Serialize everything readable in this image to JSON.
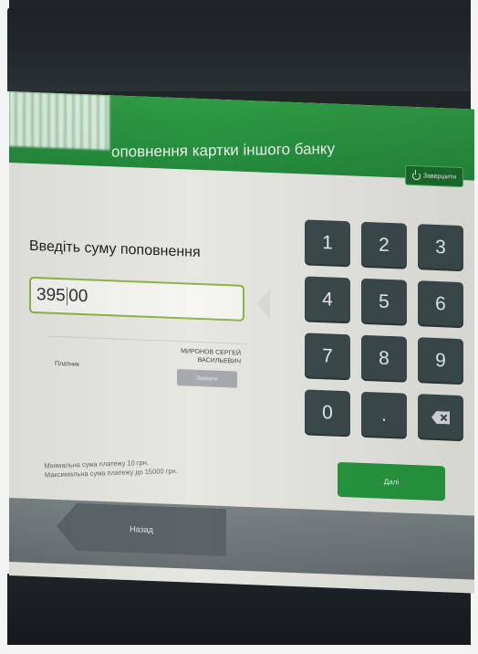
{
  "header": {
    "title": "оповнення картки іншого банку",
    "exit_label": "Завершити"
  },
  "form": {
    "prompt": "Введіть суму поповнення",
    "amount_before_caret": "395",
    "amount_after_caret": "00",
    "payer_label": "Платник",
    "payer_name": "МИРОНОВ СЕРГЕЙ ВАСИЛЬЕВИЧ",
    "change_label": "Змінити"
  },
  "keypad": {
    "keys": [
      "1",
      "2",
      "3",
      "4",
      "5",
      "6",
      "7",
      "8",
      "9",
      "0",
      "."
    ]
  },
  "info": {
    "min_text": "Мінімальна сума платежу 10 грн.",
    "max_text": "Максимальна сума платежу до 15000 грн."
  },
  "footer": {
    "back_label": "Назад",
    "next_label": "Далі"
  },
  "colors": {
    "header_green": "#2f9b45",
    "keypad_key": "#3b4a4c",
    "input_border": "#8cb64a",
    "back_button": "#5b6466"
  }
}
